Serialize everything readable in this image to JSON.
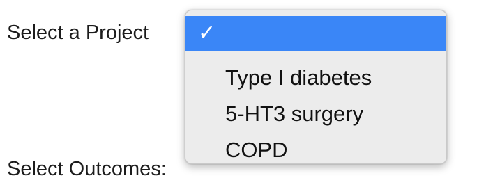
{
  "form": {
    "project_label": "Select a Project",
    "outcomes_label": "Select Outcomes:"
  },
  "dropdown": {
    "selected_index": 0,
    "checkmark": "✓",
    "options": [
      {
        "label": ""
      },
      {
        "label": "Type I diabetes"
      },
      {
        "label": "5-HT3 surgery"
      },
      {
        "label": "COPD"
      }
    ]
  },
  "colors": {
    "highlight": "#3a86f7",
    "menu_background": "#ececec",
    "divider": "#d9d9d9"
  },
  "icons": {
    "checkmark": "check-icon"
  }
}
